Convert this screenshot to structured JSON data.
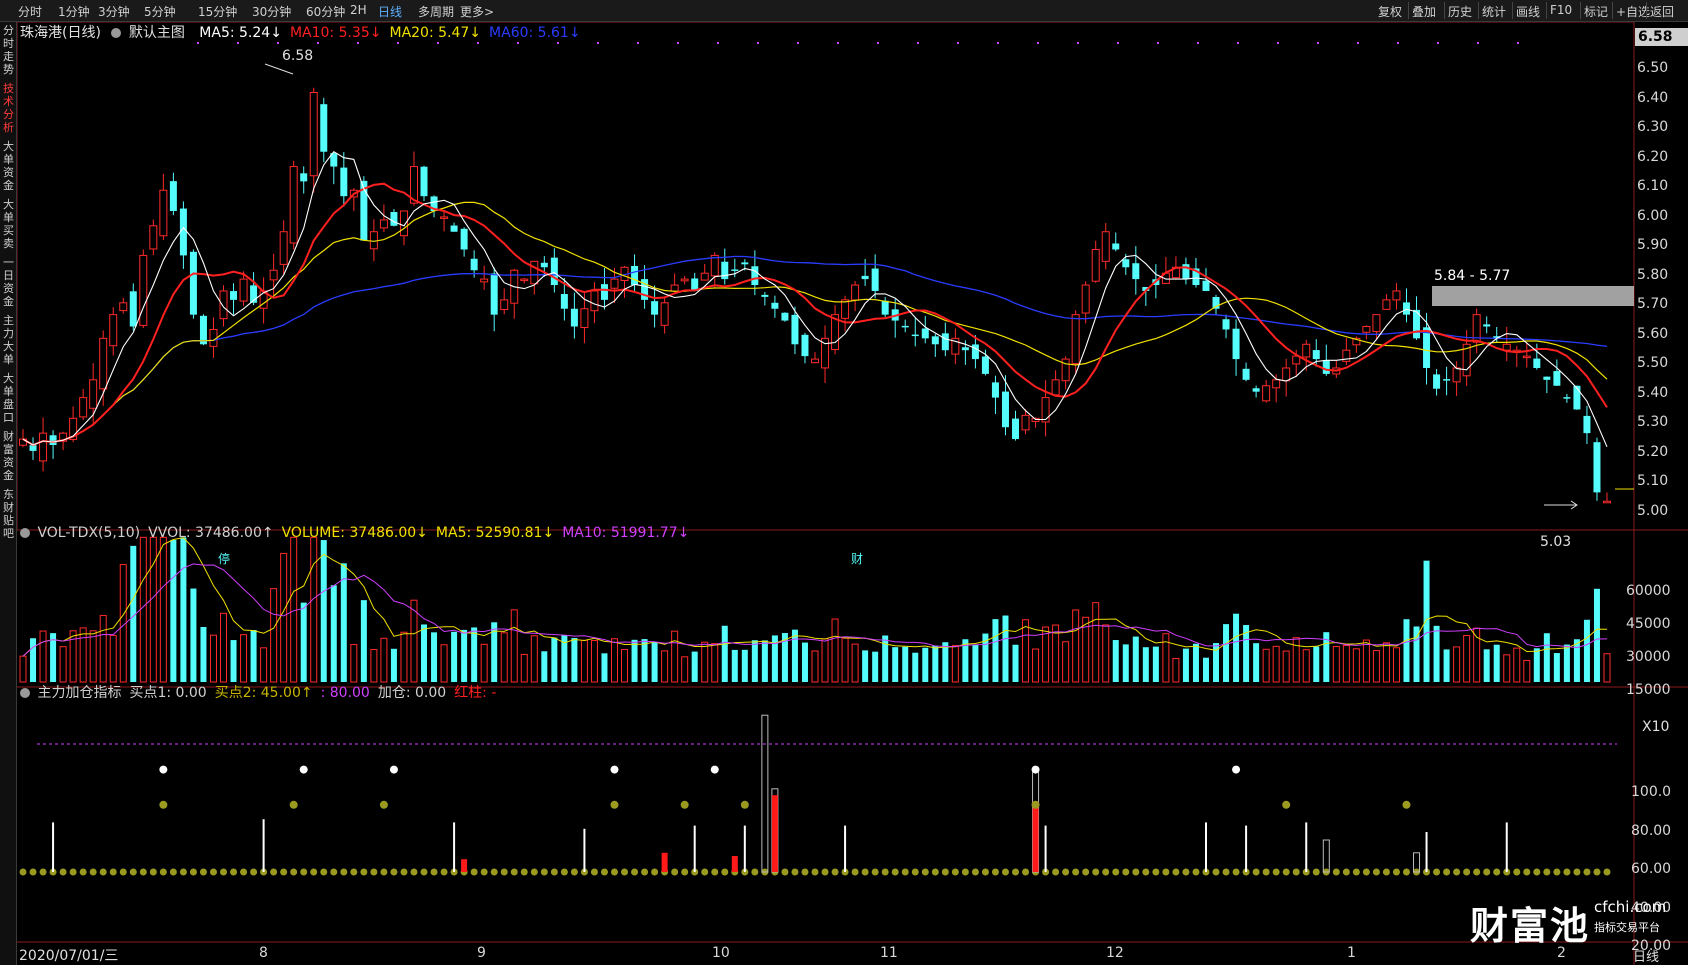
{
  "toolbar": {
    "timeframes": [
      "分时",
      "1分钟",
      "3分钟",
      "5分钟",
      "15分钟",
      "30分钟",
      "60分钟",
      "2H",
      "日线",
      "多周期",
      "更多>"
    ],
    "active_timeframe": "日线",
    "right_actions": [
      "复权",
      "叠加",
      "历史",
      "统计",
      "画线",
      "F10",
      "标记",
      "+自选",
      "返回"
    ]
  },
  "sidebar": {
    "tabs": [
      "分时走势",
      "技术分析",
      "大单资金",
      "大单买卖",
      "一日资金",
      "主力大单",
      "大单盘口",
      "财富资金",
      "东财贴吧"
    ],
    "active_tab": "技术分析"
  },
  "main_panel": {
    "stock_name": "珠海港(日线)",
    "template_label": "默认主图",
    "indicators": [
      {
        "label": "MA5: 5.24",
        "color": "#ffffff",
        "arrow": "↓"
      },
      {
        "label": "MA10: 5.35",
        "color": "#ff2020",
        "arrow": "↓"
      },
      {
        "label": "MA20: 5.47",
        "color": "#f0e000",
        "arrow": "↓"
      },
      {
        "label": "MA60: 5.61",
        "color": "#2a3cff",
        "arrow": "↓"
      }
    ],
    "current_price_tag": "6.58",
    "high_label": "6.58",
    "low_label": "5.03",
    "gap_label": "5.84 - 5.77",
    "event_markers": [
      "停",
      "财"
    ]
  },
  "volume_panel": {
    "indicators": [
      {
        "label": "VOL-TDX(5,10)",
        "color": "#d0d0d0",
        "arrow": ""
      },
      {
        "label": "VVOL: 37486.00",
        "color": "#d0d0d0",
        "arrow": "↑"
      },
      {
        "label": "VOLUME: 37486.00",
        "color": "#f0e000",
        "arrow": "↓"
      },
      {
        "label": "MA5: 52590.81",
        "color": "#f0e000",
        "arrow": "↓"
      },
      {
        "label": "MA10: 51991.77",
        "color": "#d040ff",
        "arrow": "↓"
      }
    ],
    "unit_label": "X10"
  },
  "indicator_panel": {
    "indicators": [
      {
        "label": "主力加仓指标",
        "color": "#d0d0d0",
        "arrow": ""
      },
      {
        "label": "买点1: 0.00",
        "color": "#d0d0d0",
        "arrow": ""
      },
      {
        "label": "买点2: 45.00",
        "color": "#c8b400",
        "arrow": "↑"
      },
      {
        "label": ": 80.00",
        "color": "#d040ff",
        "arrow": ""
      },
      {
        "label": "加仓: 0.00",
        "color": "#d0d0d0",
        "arrow": ""
      },
      {
        "label": "红柱: -",
        "color": "#ff2020",
        "arrow": ""
      }
    ]
  },
  "axes": {
    "price_ticks": [
      "6.50",
      "6.40",
      "6.30",
      "6.20",
      "6.10",
      "6.00",
      "5.90",
      "5.80",
      "5.70",
      "5.60",
      "5.50",
      "5.40",
      "5.30",
      "5.20",
      "5.10",
      "5.00"
    ],
    "volume_ticks": [
      "60000",
      "45000",
      "30000",
      "15000"
    ],
    "indicator_ticks": [
      "100.0",
      "80.00",
      "60.00",
      "40.00",
      "20.00"
    ],
    "date_ticks": [
      "8",
      "9",
      "10",
      "11",
      "12",
      "1",
      "2"
    ],
    "start_date": "2020/07/01/三",
    "period_label": "日线"
  },
  "watermark": {
    "brand": "财富池",
    "site": "cfchi.com",
    "slogan": "指标交易平台"
  },
  "colors": {
    "up": "#ff2a2a",
    "down": "#54fcfc",
    "ma5": "#ffffff",
    "ma10": "#ff2020",
    "ma20": "#f0e000",
    "ma60": "#2a3cff",
    "vol_ma5": "#f0e000",
    "vol_ma10": "#d040ff"
  },
  "chart_data": {
    "type": "candlestick",
    "price_range": [
      5.0,
      6.58
    ],
    "closes": [
      5.28,
      5.24,
      5.3,
      5.26,
      5.3,
      5.35,
      5.42,
      5.48,
      5.62,
      5.7,
      5.74,
      5.66,
      5.9,
      6.0,
      6.12,
      6.05,
      5.9,
      5.7,
      5.6,
      5.65,
      5.78,
      5.75,
      5.82,
      5.74,
      5.78,
      5.85,
      5.98,
      6.2,
      6.15,
      6.45,
      6.25,
      6.2,
      6.1,
      6.12,
      5.95,
      5.98,
      6.02,
      6.0,
      6.05,
      6.2,
      6.1,
      6.05,
      6.03,
      5.98,
      5.92,
      5.85,
      5.82,
      5.7,
      5.75,
      5.85,
      5.82,
      5.88,
      5.86,
      5.8,
      5.72,
      5.66,
      5.72,
      5.78,
      5.75,
      5.82,
      5.86,
      5.8,
      5.75,
      5.7,
      5.74,
      5.8,
      5.82,
      5.78,
      5.84,
      5.9,
      5.82,
      5.85,
      5.87,
      5.8,
      5.76,
      5.72,
      5.68,
      5.6,
      5.56,
      5.55,
      5.62,
      5.7,
      5.75,
      5.8,
      5.82,
      5.78,
      5.7,
      5.68,
      5.66,
      5.63,
      5.62,
      5.6,
      5.58,
      5.62,
      5.58,
      5.55,
      5.5,
      5.42,
      5.32,
      5.28,
      5.36,
      5.35,
      5.42,
      5.48,
      5.55,
      5.7,
      5.8,
      5.92,
      5.98,
      5.92,
      5.86,
      5.82,
      5.78,
      5.8,
      5.84,
      5.86,
      5.82,
      5.8,
      5.78,
      5.72,
      5.65,
      5.55,
      5.48,
      5.44,
      5.46,
      5.48,
      5.52,
      5.56,
      5.6,
      5.55,
      5.5,
      5.52,
      5.58,
      5.62,
      5.66,
      5.7,
      5.75,
      5.78,
      5.7,
      5.62,
      5.52,
      5.45,
      5.48,
      5.52,
      5.6,
      5.7,
      5.66,
      5.62,
      5.6,
      5.58,
      5.56,
      5.52,
      5.48,
      5.46,
      5.42,
      5.38,
      5.3,
      5.1,
      5.07
    ],
    "volume_range": [
      0,
      60000
    ],
    "indicator_range": [
      0,
      100
    ]
  }
}
